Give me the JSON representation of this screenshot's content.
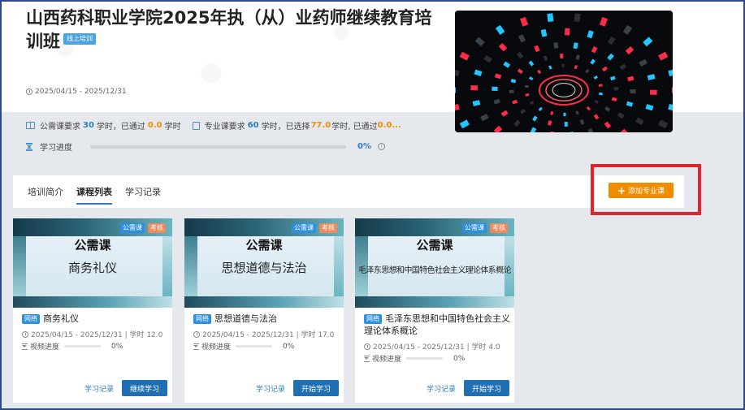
{
  "header": {
    "title": "山西药科职业学院2025年执（从）业药师继续教育培训班",
    "online_badge": "线上培训",
    "date_range": "2025/04/15 - 2025/12/31"
  },
  "requirements": {
    "public_label_a": "公需课要求",
    "public_hours": "30",
    "public_label_b": "学时，已通过",
    "public_passed": "0.0",
    "public_label_c": "学时",
    "pro_label_a": "专业课要求",
    "pro_hours": "60",
    "pro_label_b": "学时，已选择",
    "pro_selected": "77.0",
    "pro_label_c": "学时, 已通过",
    "pro_passed": "0.0..."
  },
  "progress": {
    "label": "学习进度",
    "percent_text": "0%",
    "fraction": 0
  },
  "tabs": [
    {
      "label": "培训简介",
      "active": false
    },
    {
      "label": "课程列表",
      "active": true
    },
    {
      "label": "学习记录",
      "active": false
    }
  ],
  "add_button": {
    "label": "添加专业课"
  },
  "courses": [
    {
      "cover_subtitle": "公需课",
      "cover_title": "商务礼仪",
      "tag_public": "公需课",
      "tag_exam": "考核",
      "tag_net": "网络",
      "title": "商务礼仪",
      "meta": "2025/04/15 - 2025/12/31 | 学时 12.0",
      "progress_label": "视频进度",
      "progress_text": "0%",
      "progress_fraction": 0,
      "record_label": "学习记录",
      "action_label": "继续学习"
    },
    {
      "cover_subtitle": "公需课",
      "cover_title": "思想道德与法治",
      "tag_public": "公需课",
      "tag_exam": "考核",
      "tag_net": "网络",
      "title": "思想道德与法治",
      "meta": "2025/04/15 - 2025/12/31 | 学时 17.0",
      "progress_label": "视频进度",
      "progress_text": "0%",
      "progress_fraction": 0,
      "record_label": "学习记录",
      "action_label": "开始学习"
    },
    {
      "cover_subtitle": "公需课",
      "cover_title": "毛泽东思想和中国特色社会主义理论体系概论",
      "tag_public": "公需课",
      "tag_exam": "考核",
      "tag_net": "网络",
      "title": "毛泽东思想和中国特色社会主义理论体系概论",
      "meta": "2025/04/15 - 2025/12/31 | 学时 4.0",
      "progress_label": "视频进度",
      "progress_text": "0%",
      "progress_fraction": 0,
      "record_label": "学习记录",
      "action_label": "开始学习"
    }
  ],
  "colors": {
    "accent_blue": "#2d7fc1",
    "orange": "#f08c00",
    "highlight_red": "#e0262d",
    "button_blue": "#1f6fb2"
  }
}
